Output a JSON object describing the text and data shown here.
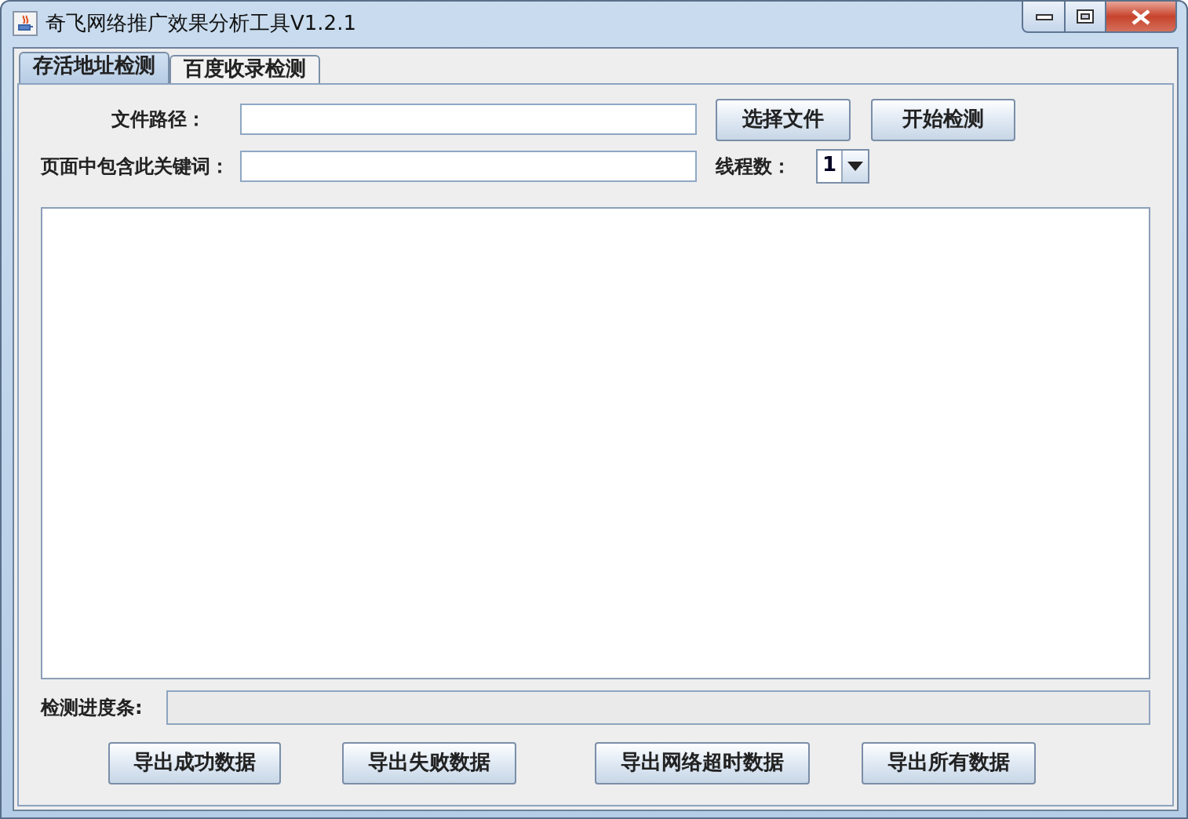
{
  "window": {
    "title": "奇飞网络推广效果分析工具V1.2.1"
  },
  "tabs": [
    {
      "label": "存活地址检测",
      "selected": true
    },
    {
      "label": "百度收录检测",
      "selected": false
    }
  ],
  "file_path": {
    "label": "文件路径："
  },
  "action_buttons": [
    "选择文件",
    "开始检测"
  ],
  "keyword": {
    "label": "页面中包含此关键词："
  },
  "threads": {
    "label": "线程数：",
    "value": "1"
  },
  "progress": {
    "label": "检测进度条:",
    "level": 0
  },
  "export_buttons": [
    "导出成功数据",
    "导出失败数据",
    "导出网络超时数据",
    "导出所有数据"
  ]
}
